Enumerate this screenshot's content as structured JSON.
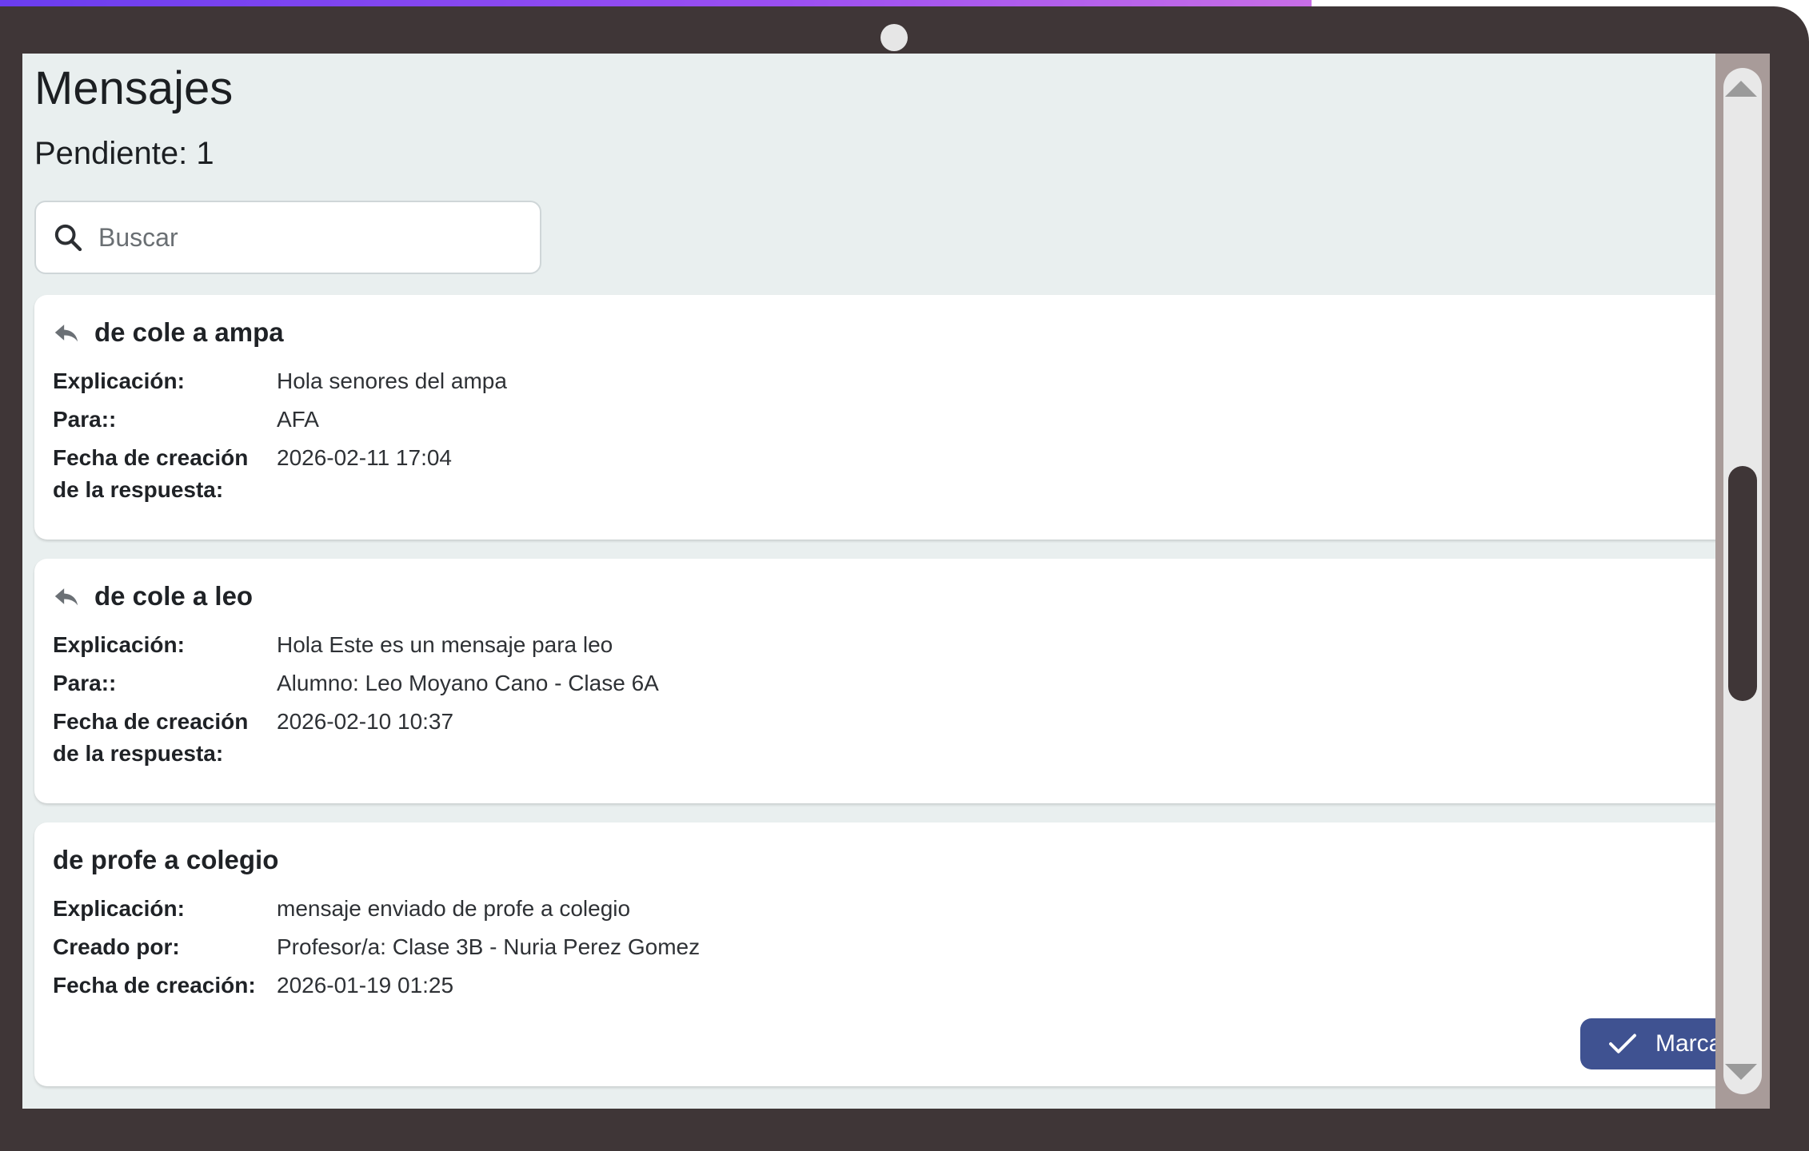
{
  "header": {
    "title": "Mensajes",
    "pending": "Pendiente: 1"
  },
  "search": {
    "placeholder": "Buscar"
  },
  "messages": [
    {
      "title": "de cole a ampa",
      "icon": "reply-icon",
      "fields": [
        {
          "label": "Explicación:",
          "value": "Hola senores del ampa"
        },
        {
          "label": "Para::",
          "value": "AFA"
        },
        {
          "label": "Fecha de creación de la respuesta:",
          "value": "2026-02-11 17:04"
        }
      ]
    },
    {
      "title": "de cole a leo",
      "icon": "reply-icon",
      "fields": [
        {
          "label": "Explicación:",
          "value": "Hola Este es un mensaje para leo"
        },
        {
          "label": "Para::",
          "value": "Alumno: Leo Moyano Cano - Clase 6A"
        },
        {
          "label": "Fecha de creación de la respuesta:",
          "value": "2026-02-10 10:37"
        }
      ]
    },
    {
      "title": "de profe a colegio",
      "fields": [
        {
          "label": "Explicación:",
          "value": "mensaje enviado de profe a colegio"
        },
        {
          "label": "Creado por:",
          "value": "Profesor/a: Clase 3B - Nuria Perez Gomez"
        },
        {
          "label": "Fecha de creación:",
          "value": "2026-01-19 01:25"
        }
      ],
      "action_label": "Marca"
    }
  ],
  "colors": {
    "accent": "#3f5291",
    "background": "#e9efef",
    "frame": "#3f3637"
  }
}
